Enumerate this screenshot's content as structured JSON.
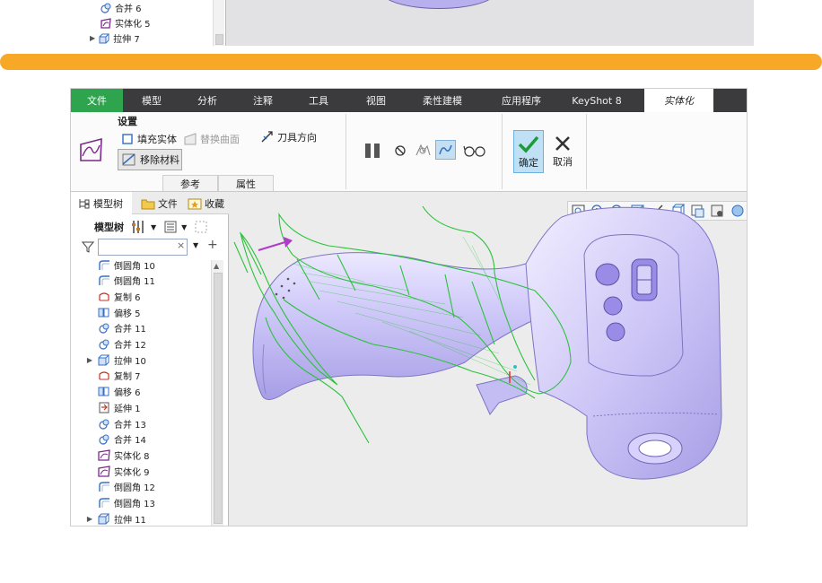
{
  "top_crop": {
    "tree_items": [
      {
        "label": "合并 6",
        "icon": "merge-icon"
      },
      {
        "label": "实体化 5",
        "icon": "solidify-icon"
      },
      {
        "label": "拉伸 7",
        "icon": "extrude-icon"
      }
    ]
  },
  "ribbon": {
    "tabs": [
      "文件",
      "模型",
      "分析",
      "注释",
      "工具",
      "视图",
      "柔性建模",
      "应用程序",
      "KeyShot 8",
      "实体化"
    ],
    "active_tab": "实体化",
    "settings_title": "设置",
    "fill_solid": "填充实体",
    "replace_surface": "替换曲面",
    "tool_direction": "刀具方向",
    "remove_material": "移除材料",
    "references_tab": "参考",
    "properties_tab": "属性",
    "confirm": "确定",
    "cancel": "取消"
  },
  "panel": {
    "tabs": [
      "模型树",
      "文件",
      "收藏"
    ],
    "tree_title": "模型树",
    "filter_placeholder": "",
    "items": [
      {
        "label": "倒圆角 10",
        "icon": "round-icon",
        "expandable": false
      },
      {
        "label": "倒圆角 11",
        "icon": "round-icon",
        "expandable": false
      },
      {
        "label": "复制 6",
        "icon": "copy-icon",
        "expandable": false
      },
      {
        "label": "偏移 5",
        "icon": "offset-icon",
        "expandable": false
      },
      {
        "label": "合并 11",
        "icon": "merge-icon",
        "expandable": false
      },
      {
        "label": "合并 12",
        "icon": "merge-icon",
        "expandable": false
      },
      {
        "label": "拉伸 10",
        "icon": "extrude-icon",
        "expandable": true
      },
      {
        "label": "复制 7",
        "icon": "copy-icon",
        "expandable": false
      },
      {
        "label": "偏移 6",
        "icon": "offset-icon",
        "expandable": false
      },
      {
        "label": "延伸 1",
        "icon": "extend-icon",
        "expandable": false
      },
      {
        "label": "合并 13",
        "icon": "merge-icon",
        "expandable": false
      },
      {
        "label": "合并 14",
        "icon": "merge-icon",
        "expandable": false
      },
      {
        "label": "实体化 8",
        "icon": "solidify-icon",
        "expandable": false
      },
      {
        "label": "实体化 9",
        "icon": "solidify-icon",
        "expandable": false
      },
      {
        "label": "倒圆角 12",
        "icon": "round-icon",
        "expandable": false
      },
      {
        "label": "倒圆角 13",
        "icon": "round-icon",
        "expandable": false
      },
      {
        "label": "拉伸 11",
        "icon": "extrude-icon",
        "expandable": true
      }
    ]
  },
  "colors": {
    "divider": "#f7a826",
    "file_tab": "#2ea44f",
    "part_fill": "#c5bdf4",
    "wireframe": "#2bc23a",
    "arrow": "#b03cc8"
  }
}
